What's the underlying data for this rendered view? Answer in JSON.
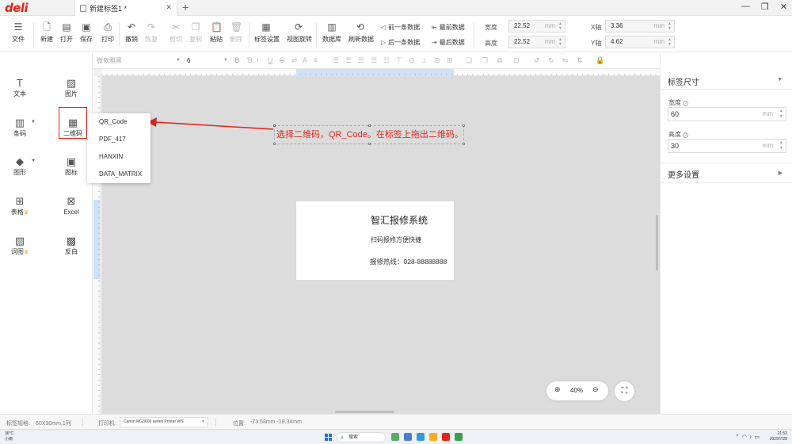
{
  "titlebar": {
    "logo": "deli",
    "tab_title": "新建标签1 *",
    "new_tab": "+"
  },
  "toolbar": {
    "file": "文件",
    "new": "新建",
    "open": "打开",
    "save": "保存",
    "print": "打印",
    "undo": "撤销",
    "redo": "恢复",
    "cut": "剪切",
    "copy": "复制",
    "paste": "粘贴",
    "delete": "删除",
    "label_settings": "标签设置",
    "view_rotate": "视图旋转",
    "database": "数据库",
    "refresh_data": "刷新数据",
    "prev_record": "前一条数据",
    "first_record": "最前数据",
    "next_record": "后一条数据",
    "last_record": "最后数据",
    "width_label": "宽度",
    "width_value": "22.52",
    "height_label": "高度",
    "height_value": "22.52",
    "x_label": "X轴",
    "x_value": "3.36",
    "y_label": "Y轴",
    "y_value": "4.62",
    "unit": "mm"
  },
  "format": {
    "font": "微软雅黑",
    "size": "6"
  },
  "tools": {
    "text": "文本",
    "image": "图片",
    "barcode": "条码",
    "qrcode": "二维码",
    "shape": "图形",
    "icon": "图标",
    "table": "表格",
    "excel": "Excel",
    "chart": "词图",
    "invert": "反白"
  },
  "qr_menu": [
    "QR_Code",
    "PDF_417",
    "HANXIN",
    "DATA_MATRIX"
  ],
  "annotation": "选择二维码，QR_Code。在标签上拖出二维码。",
  "label": {
    "title": "智汇报修系统",
    "subtitle": "扫码报修方便快捷",
    "phone": "报修热线：028-88888888"
  },
  "zoom": {
    "value": "40%"
  },
  "right_panel": {
    "section_title": "标签尺寸",
    "width_label": "宽度",
    "width_value": "60",
    "height_label": "高度",
    "height_value": "30",
    "unit": "mm",
    "more_settings": "更多设置"
  },
  "status": {
    "label_spec_key": "标签规格:",
    "label_spec_value": "60X30mm,1列",
    "printer_key": "打印机:",
    "printer_value": "Canon MG3600 series Printer WS",
    "position_key": "位置:",
    "position_value": "-73.58mm -18.34mm"
  },
  "taskbar": {
    "temp": "36°C",
    "weather": "小雨",
    "search": "搜索",
    "time": "21:52",
    "date": "2029/7/28"
  }
}
